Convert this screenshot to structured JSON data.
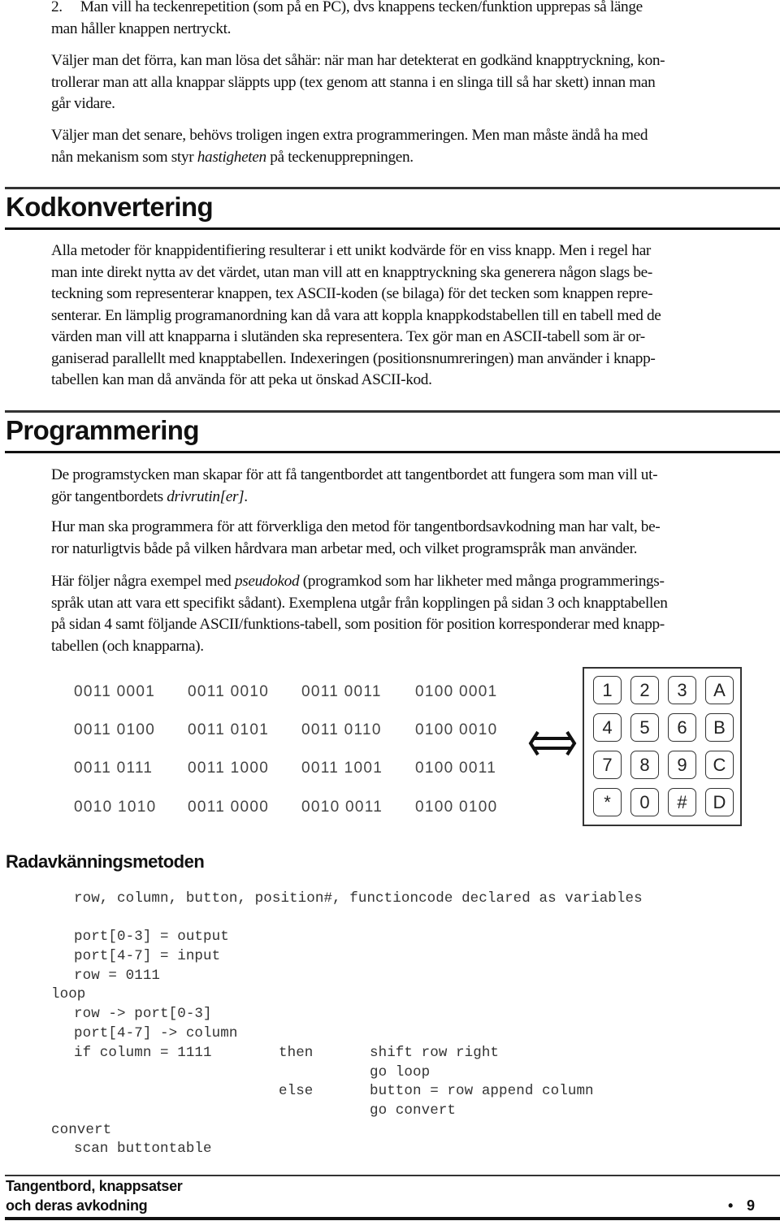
{
  "intro": {
    "item2_number": "2.",
    "item2_line1": "Man vill ha teckenrepetition (som på en PC), dvs knappens tecken/funktion upprepas så länge",
    "item2_line2": "man håller knappen nertryckt.",
    "p1_line1": "Väljer man det förra, kan man lösa det såhär: när man har detekterat en godkänd knapptryckning, kon-",
    "p1_line2": "trollerar man att alla knappar släppts upp (tex genom att stanna i en slinga till så har skett) innan man",
    "p1_line3": "går vidare.",
    "p2_line1": "Väljer man det senare, behövs troligen ingen extra programmeringen. Men man måste ändå ha med",
    "p2_line2_pre": "nån mekanism som styr ",
    "p2_line2_italic": "hastigheten",
    "p2_line2_post": " på teckenupprepningen."
  },
  "kodkonvertering": {
    "heading": "Kodkonvertering",
    "lines": [
      "Alla metoder för knappidentifiering resulterar i ett unikt kodvärde för en viss knapp. Men i regel har",
      "man inte direkt nytta av det värdet, utan man vill att en knapptryckning ska generera någon slags be-",
      "teckning som representerar knappen, tex ASCII-koden (se bilaga) för det tecken som knappen repre-",
      "senterar. En lämplig programanordning kan då vara att koppla knappkodstabellen till en tabell med de",
      "värden man vill att knapparna i slutänden ska representera. Tex gör man en ASCII-tabell som är or-",
      "ganiserad parallellt med knapptabellen. Indexeringen (positionsnumreringen) man använder i knapp-",
      "tabellen kan man då använda för att peka ut önskad ASCII-kod."
    ]
  },
  "programmering": {
    "heading": "Programmering",
    "p1_line1": "De programstycken man skapar för att få tangentbordet att tangentbordet att fungera som man vill ut-",
    "p1_line2_pre": "gör tangentbordets ",
    "p1_line2_italic": "drivrutin[er]",
    "p1_line2_post": ".",
    "p2_line1": "Hur man ska programmera för att förverkliga den metod för tangentbordsavkodning man har valt, be-",
    "p2_line2": "ror naturligtvis både på vilken hårdvara man arbetar med, och vilket programspråk man använder.",
    "p3_line1_pre": "Här följer några exempel med ",
    "p3_line1_italic": "pseudokod",
    "p3_line1_post": " (programkod som har likheter med många programmerings-",
    "p3_line2": "språk utan att vara ett specifikt sådant). Exemplena utgår från kopplingen på sidan 3 och knapptabellen",
    "p3_line3": "på sidan 4 samt följande ASCII/funktions-tabell, som position för position korresponderar med knapp-",
    "p3_line4": "tabellen (och knapparna)."
  },
  "ascii_table": [
    [
      "0011 0001",
      "0011 0010",
      "0011 0011",
      "0100 0001"
    ],
    [
      "0011 0100",
      "0011 0101",
      "0011 0110",
      "0100 0010"
    ],
    [
      "0011 0111",
      "0011 1000",
      "0011 1001",
      "0100 0011"
    ],
    [
      "0010 1010",
      "0011 0000",
      "0010 0011",
      "0100 0100"
    ]
  ],
  "arrow_icon": "double-arrow-left-right",
  "keypad": [
    [
      "1",
      "2",
      "3",
      "A"
    ],
    [
      "4",
      "5",
      "6",
      "B"
    ],
    [
      "7",
      "8",
      "9",
      "C"
    ],
    [
      "*",
      "0",
      "#",
      "D"
    ]
  ],
  "radavkanning": {
    "heading": "Radavkänningsmetoden",
    "code": {
      "decl": "row, column, button, position#, functioncode declared as variables",
      "port_out": "port[0-3] = output",
      "port_in": "port[4-7] = input",
      "row_init": "row = 0111",
      "loop_label": "loop",
      "row_to_port": "row -> port[0-3]",
      "port_to_col": "port[4-7] -> column",
      "if_stmt": "if column = 1111",
      "then_kw": "then",
      "shift": "shift row right",
      "go_loop": "go loop",
      "else_kw": "else",
      "button_assign": "button = row append column",
      "go_convert": "go convert",
      "convert_label": "convert",
      "scan": "scan buttontable"
    }
  },
  "footer": {
    "title_line1": "Tangentbord, knappsatser",
    "title_line2": "och deras avkodning",
    "bullet": "•",
    "page_number": "9"
  }
}
